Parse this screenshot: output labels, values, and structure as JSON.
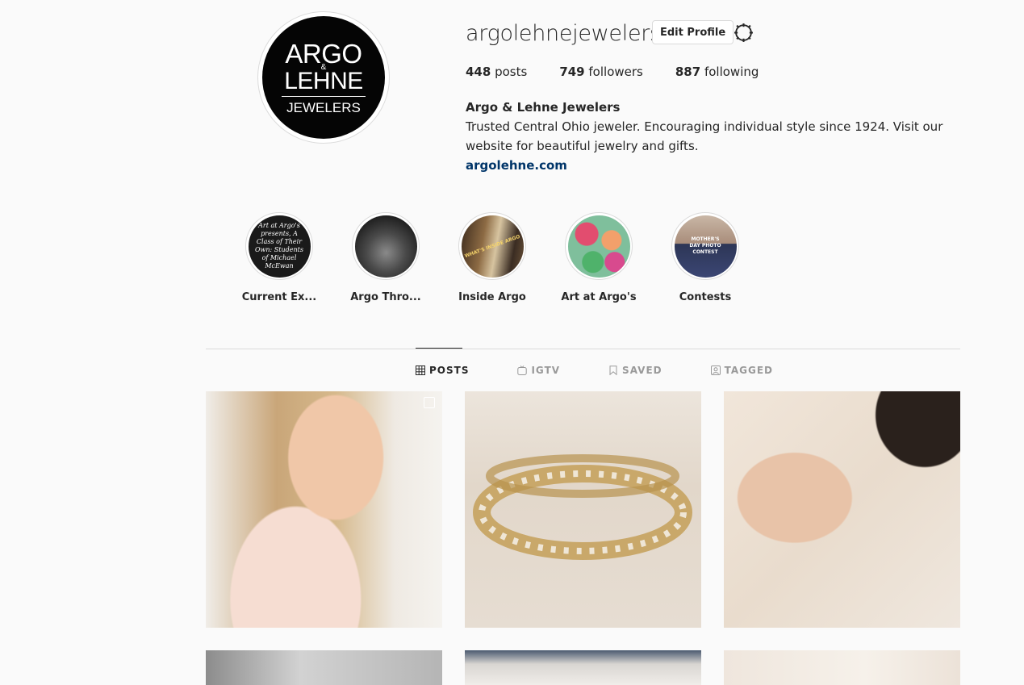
{
  "profile": {
    "username": "argolehnejewelers",
    "edit_label": "Edit Profile",
    "logo": {
      "line1": "ARGO",
      "amp": "&",
      "line2": "LEHNE",
      "line3": "JEWELERS"
    },
    "stats": {
      "posts_count": "448",
      "posts_label": "posts",
      "followers_count": "749",
      "followers_label": "followers",
      "following_count": "887",
      "following_label": "following"
    },
    "full_name": "Argo & Lehne Jewelers",
    "bio": "Trusted Central Ohio jeweler. Encouraging individual style since 1924. Visit our website for beautiful jewelry and gifts.",
    "website": "argolehne.com"
  },
  "highlights": [
    {
      "label": "Current Ex...",
      "cover_text": "Art at Argo's presents, A Class of Their Own: Students of Michael McEwan"
    },
    {
      "label": "Argo Thro..."
    },
    {
      "label": "Inside Argo",
      "cover_text": "WHAT'S INSIDE ARGO"
    },
    {
      "label": "Art at Argo's"
    },
    {
      "label": "Contests",
      "cover_text": "MOTHER'S DAY PHOTO CONTEST"
    }
  ],
  "tabs": [
    {
      "label": "POSTS",
      "icon": "grid-icon",
      "active": true
    },
    {
      "label": "IGTV",
      "icon": "igtv-icon",
      "active": false
    },
    {
      "label": "SAVED",
      "icon": "bookmark-icon",
      "active": false
    },
    {
      "label": "TAGGED",
      "icon": "tagged-icon",
      "active": false
    }
  ],
  "colors": {
    "background": "#fafafa",
    "link": "#003569",
    "border": "#dbdbdb",
    "text": "#262626",
    "muted": "#999999"
  }
}
